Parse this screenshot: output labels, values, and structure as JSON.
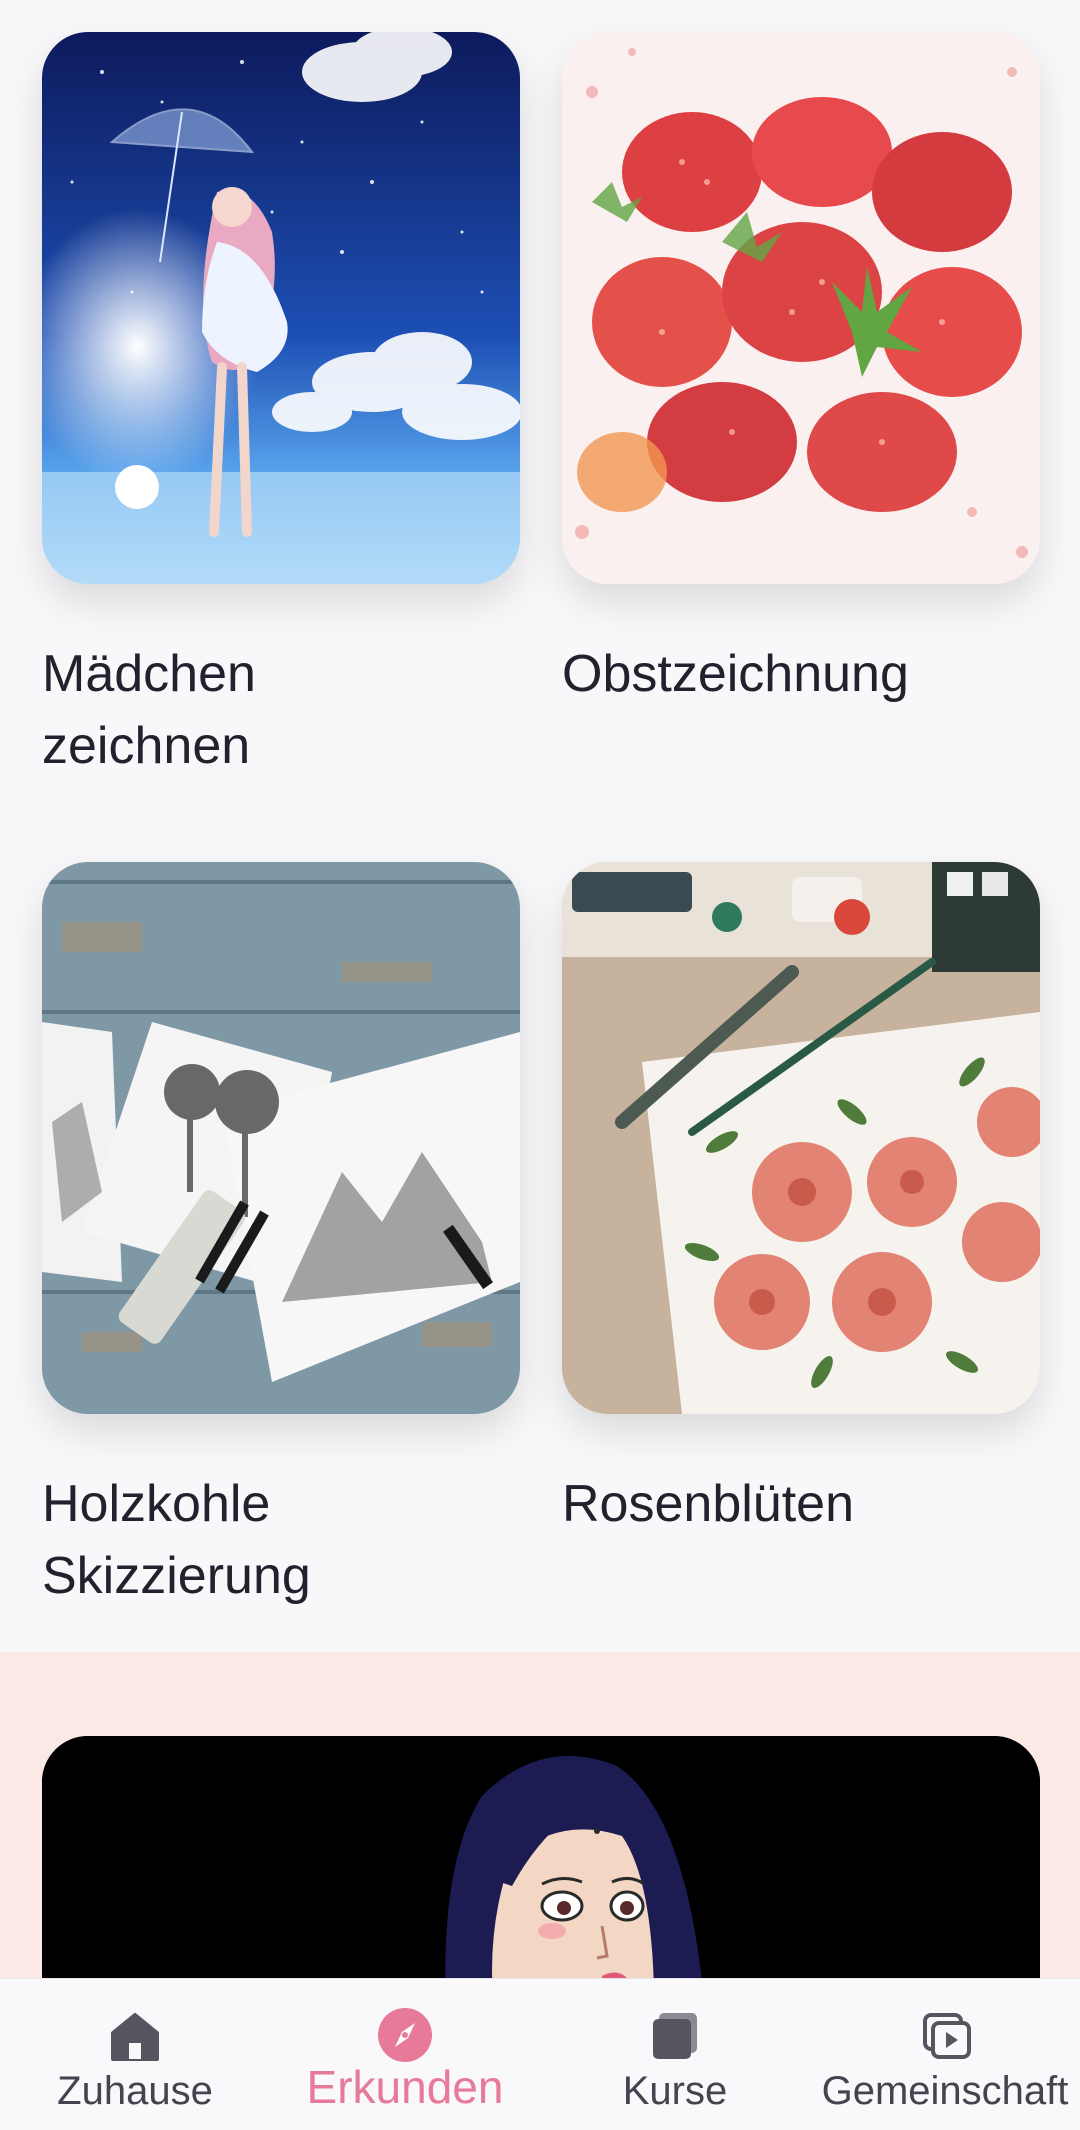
{
  "cards": [
    {
      "title_line1": "Mädchen",
      "title_line2": "zeichnen"
    },
    {
      "title_line1": "Obstzeichnung",
      "title_line2": ""
    },
    {
      "title_line1": "Holzkohle",
      "title_line2": "Skizzierung"
    },
    {
      "title_line1": "Rosenblüten",
      "title_line2": ""
    }
  ],
  "bottom_nav": {
    "items": [
      {
        "label": "Zuhause",
        "icon": "home-icon"
      },
      {
        "label": "Erkunden",
        "icon": "compass-icon",
        "active": true
      },
      {
        "label": "Kurse",
        "icon": "book-stack-icon"
      },
      {
        "label": "Gemeinschaft",
        "icon": "video-stack-icon"
      }
    ]
  },
  "colors": {
    "accent": "#e77a98",
    "background": "#f8f8fa",
    "promo_band": "#fbe9e6",
    "text": "#22212e"
  }
}
